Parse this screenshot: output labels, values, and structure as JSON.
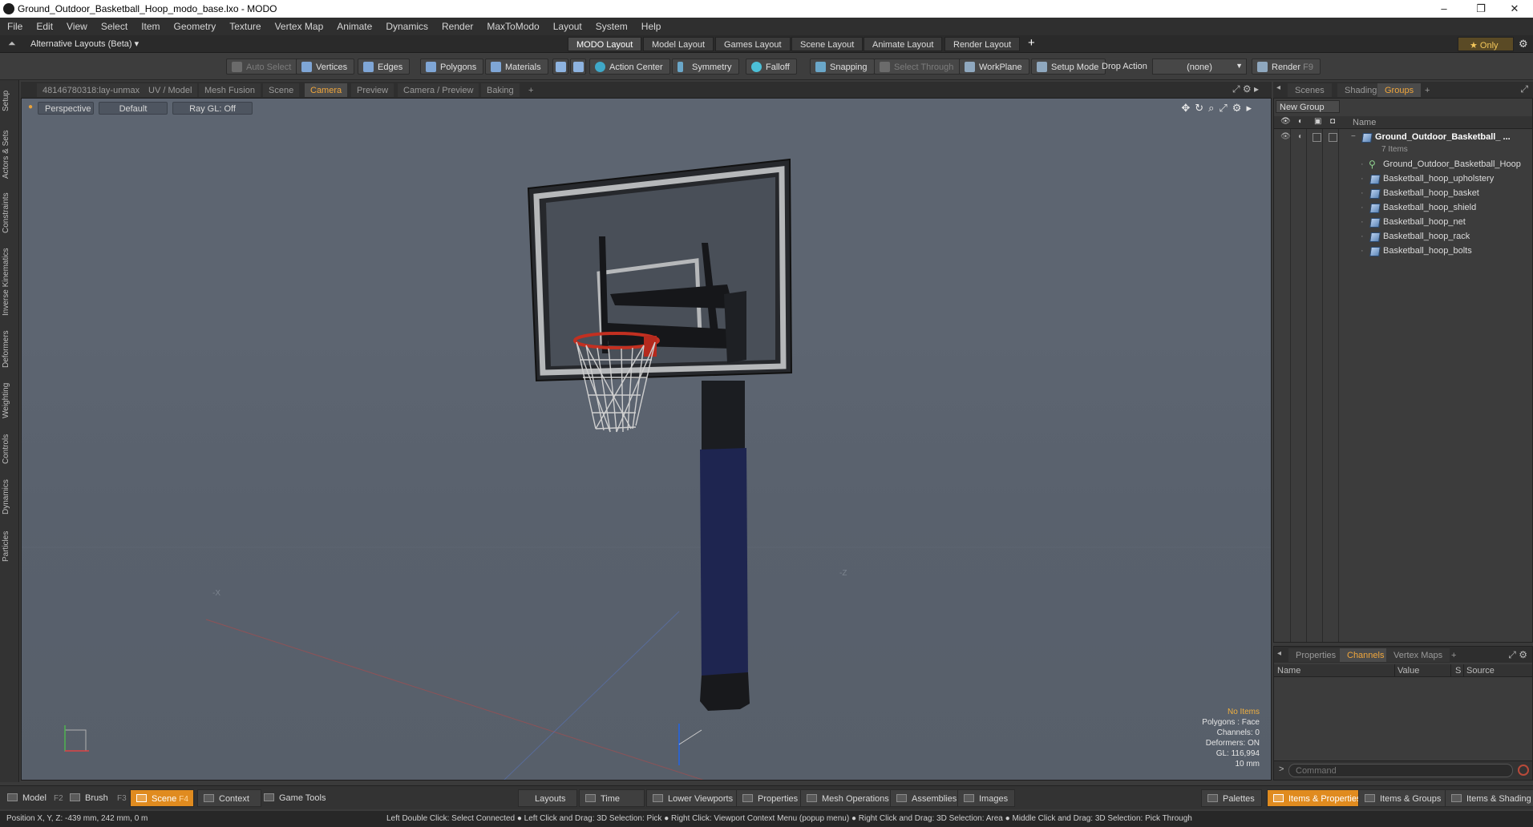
{
  "window": {
    "title": "Ground_Outdoor_Basketball_Hoop_modo_base.lxo - MODO",
    "minimize": "–",
    "maximize": "❐",
    "close": "✕"
  },
  "menu": [
    "File",
    "Edit",
    "View",
    "Select",
    "Item",
    "Geometry",
    "Texture",
    "Vertex Map",
    "Animate",
    "Dynamics",
    "Render",
    "MaxToModo",
    "Layout",
    "System",
    "Help"
  ],
  "layoutbar": {
    "alt_layouts": "Alternative Layouts (Beta) ▾",
    "tabs": [
      "MODO Layout",
      "Model Layout",
      "Games Layout",
      "Scene Layout",
      "Animate Layout",
      "Render Layout"
    ],
    "add": "+",
    "only": "★  Only"
  },
  "toolbar": {
    "auto_select": "Auto Select",
    "vertices": "Vertices",
    "edges": "Edges",
    "polygons": "Polygons",
    "materials": "Materials",
    "action_center": "Action Center",
    "symmetry": "Symmetry",
    "falloff": "Falloff",
    "snapping": "Snapping",
    "select_through": "Select Through",
    "workplane": "WorkPlane",
    "setup_mode": "Setup Mode",
    "drop_action_label": "Drop Action",
    "drop_action_value": "(none)",
    "render": "Render",
    "render_key": "F9"
  },
  "left_tabs": [
    "Setup",
    "Actors & Sets",
    "Constraints",
    "Inverse Kinematics",
    "Deformers",
    "Weighting",
    "Controls",
    "Dynamics",
    "Particles"
  ],
  "viewport_tabs": [
    "48146780318:lay-unmax",
    "UV / Model",
    "Mesh Fusion",
    "Scene",
    "Camera",
    "Preview",
    "Camera / Preview",
    "Baking",
    "+"
  ],
  "viewport": {
    "view": "Perspective",
    "shading": "Default",
    "raygl": "Ray GL: Off",
    "info": {
      "items": "No Items",
      "polygons": "Polygons : Face",
      "channels": "Channels: 0",
      "deformers": "Deformers: ON",
      "gl": "GL: 116,994",
      "scale": "10 mm"
    },
    "axis_label": "Z"
  },
  "right_tabs": [
    "Scenes",
    "Shading",
    "Groups",
    "+"
  ],
  "groups": {
    "new_group": "New Group",
    "name_header": "Name",
    "root": "Ground_Outdoor_Basketball_ ...",
    "count": "7 Items",
    "items": [
      "Ground_Outdoor_Basketball_Hoop",
      "Basketball_hoop_upholstery",
      "Basketball_hoop_basket",
      "Basketball_hoop_shield",
      "Basketball_hoop_net",
      "Basketball_hoop_rack",
      "Basketball_hoop_bolts"
    ]
  },
  "props_tabs": [
    "Properties",
    "Channels",
    "Vertex Maps",
    "+"
  ],
  "channels": {
    "name": "Name",
    "value": "Value",
    "s": "S",
    "source": "Source"
  },
  "command_placeholder": "Command",
  "bottom": {
    "model": "Model",
    "model_key": "F2",
    "brush": "Brush",
    "brush_key": "F3",
    "scene": "Scene",
    "scene_key": "F4",
    "context": "Context",
    "game_tools": "Game Tools",
    "layouts": "Layouts",
    "time": "Time",
    "lower_viewports": "Lower Viewports",
    "properties": "Properties",
    "mesh_operations": "Mesh Operations",
    "assemblies": "Assemblies",
    "images": "Images",
    "palettes": "Palettes",
    "items_properties": "Items & Properties",
    "items_groups": "Items & Groups",
    "items_shading": "Items & Shading"
  },
  "status": {
    "position": "Position X, Y, Z:   -439 mm, 242 mm, 0 m",
    "hints": "Left Double Click: Select Connected ● Left Click and Drag: 3D Selection: Pick ● Right Click: Viewport Context Menu (popup menu) ● Right Click and Drag: 3D Selection: Area ● Middle Click and Drag: 3D Selection: Pick Through"
  }
}
